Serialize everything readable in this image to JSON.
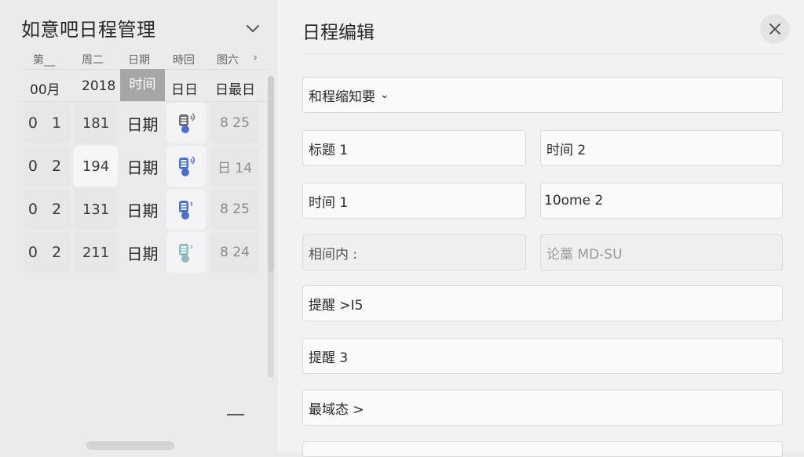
{
  "app": {
    "title": "如意吧日程管理"
  },
  "calendar": {
    "weekdays": [
      "第__",
      "周二",
      "日期",
      "時回",
      "图六"
    ],
    "headers": [
      "00月",
      "2018",
      "时间",
      "日日",
      "日最日"
    ],
    "rows": [
      {
        "c1": "0 1",
        "c2": "181",
        "c3": "日期",
        "icon": "music-note-icon",
        "c5": "8 25"
      },
      {
        "c1": "0 2",
        "c2": "194",
        "c3": "日期",
        "icon": "music-note-icon",
        "c5": "日 14"
      },
      {
        "c1": "0 2",
        "c2": "131",
        "c3": "日期",
        "icon": "music-note-icon",
        "c5": "8 25"
      },
      {
        "c1": "0 2",
        "c2": "211",
        "c3": "日期",
        "icon": "music-note-icon",
        "c5": "8 24"
      }
    ]
  },
  "editor": {
    "title": "日程编辑",
    "dropdown_label": "和程缩知要",
    "fields": {
      "title1": "标题 1",
      "time2": "时间 2",
      "time1": "时间 1",
      "home2": "10ome 2",
      "content_label": "相间内 :",
      "content_placeholder": "论藁 MD-SU",
      "reminder1": "提醒 >I5",
      "reminder3": "提醒 3",
      "domain": "最域态 >"
    }
  },
  "colors": {
    "accent": "#4a6fd0",
    "muted_accent": "#8fbcc0",
    "header_highlight": "#a6a6a8"
  }
}
